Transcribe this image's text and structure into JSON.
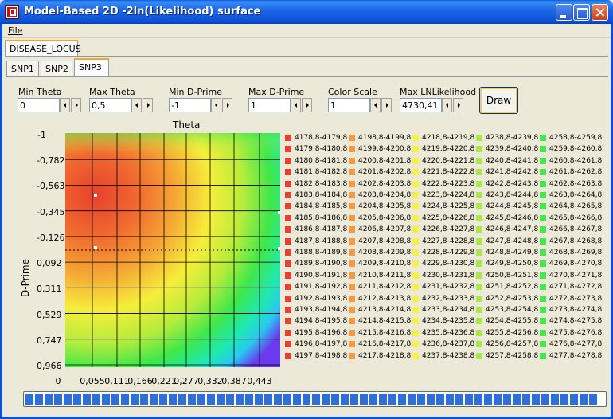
{
  "window": {
    "title": "Model-Based 2D -2ln(Likelihood) surface"
  },
  "menu": {
    "file": "File"
  },
  "tabs": {
    "outer": "DISEASE_LOCUS",
    "inner": [
      "SNP1",
      "SNP2",
      "SNP3"
    ],
    "active": "SNP3"
  },
  "controls": {
    "min_theta": {
      "label": "Min Theta",
      "value": "0"
    },
    "max_theta": {
      "label": "Max Theta",
      "value": "0,5"
    },
    "min_dprime": {
      "label": "Min D-Prime",
      "value": "-1"
    },
    "max_dprime": {
      "label": "Max D-Prime",
      "value": "1"
    },
    "color_scale": {
      "label": "Color Scale",
      "value": "1"
    },
    "max_lnlikelihood": {
      "label": "Max LNLikelihood",
      "value": "4730,41"
    },
    "draw": "Draw"
  },
  "chart_data": {
    "type": "heatmap",
    "title": "",
    "xlabel": "Theta",
    "ylabel": "D-Prime",
    "x_ticks": [
      "0",
      "0,055",
      "0,111",
      "0,166",
      "0,221",
      "0,277",
      "0,332",
      "0,387",
      "0,443"
    ],
    "y_ticks": [
      "-1",
      "-0,782",
      "-0,563",
      "-0,345",
      "-0,126",
      "0,092",
      "0,311",
      "0,529",
      "0,747",
      "0,966"
    ],
    "xlim": [
      0,
      0.5
    ],
    "ylim": [
      -1,
      1
    ],
    "grid": true,
    "dashed_line_dprime": 0.0,
    "markers": [
      {
        "theta": 0.06,
        "dprime": -0.47
      },
      {
        "theta": 0.06,
        "dprime": -0.02
      }
    ],
    "legend": {
      "columns": [
        {
          "color": "#e8412d",
          "entries": [
            "4178,8-4179,8",
            "4179,8-4180,8",
            "4180,8-4181,8",
            "4181,8-4182,8",
            "4182,8-4183,8",
            "4183,8-4184,8",
            "4184,8-4185,8",
            "4185,8-4186,8",
            "4186,8-4187,8",
            "4187,8-4188,8",
            "4188,8-4189,8",
            "4189,8-4190,8",
            "4190,8-4191,8",
            "4191,8-4192,8",
            "4192,8-4193,8",
            "4193,8-4194,8",
            "4194,8-4195,8",
            "4195,8-4196,8",
            "4196,8-4197,8",
            "4197,8-4198,8"
          ]
        },
        {
          "color": "#f29a45",
          "entries": [
            "4198,8-4199,8",
            "4199,8-4200,8",
            "4200,8-4201,8",
            "4201,8-4202,8",
            "4202,8-4203,8",
            "4203,8-4204,8",
            "4204,8-4205,8",
            "4205,8-4206,8",
            "4206,8-4207,8",
            "4207,8-4208,8",
            "4208,8-4209,8",
            "4209,8-4210,8",
            "4210,8-4211,8",
            "4211,8-4212,8",
            "4212,8-4213,8",
            "4213,8-4214,8",
            "4214,8-4215,8",
            "4215,8-4216,8",
            "4216,8-4217,8",
            "4217,8-4218,8"
          ]
        },
        {
          "color": "#f7ef4a",
          "entries": [
            "4218,8-4219,8",
            "4219,8-4220,8",
            "4220,8-4221,8",
            "4221,8-4222,8",
            "4222,8-4223,8",
            "4223,8-4224,8",
            "4224,8-4225,8",
            "4225,8-4226,8",
            "4226,8-4227,8",
            "4227,8-4228,8",
            "4228,8-4229,8",
            "4229,8-4230,8",
            "4230,8-4231,8",
            "4231,8-4232,8",
            "4232,8-4233,8",
            "4233,8-4234,8",
            "4234,8-4235,8",
            "4235,8-4236,8",
            "4236,8-4237,8",
            "4237,8-4238,8"
          ]
        },
        {
          "color": "#a9e84a",
          "entries": [
            "4238,8-4239,8",
            "4239,8-4240,8",
            "4240,8-4241,8",
            "4241,8-4242,8",
            "4242,8-4243,8",
            "4243,8-4244,8",
            "4244,8-4245,8",
            "4245,8-4246,8",
            "4246,8-4247,8",
            "4247,8-4248,8",
            "4248,8-4249,8",
            "4249,8-4250,8",
            "4250,8-4251,8",
            "4251,8-4252,8",
            "4252,8-4253,8",
            "4253,8-4254,8",
            "4254,8-4255,8",
            "4255,8-4256,8",
            "4256,8-4257,8",
            "4257,8-4258,8"
          ]
        },
        {
          "color": "#45e84a",
          "entries": [
            "4258,8-4259,8",
            "4259,8-4260,8",
            "4260,8-4261,8",
            "4261,8-4262,8",
            "4262,8-4263,8",
            "4263,8-4264,8",
            "4264,8-4265,8",
            "4265,8-4266,8",
            "4266,8-4267,8",
            "4267,8-4268,8",
            "4268,8-4269,8",
            "4269,8-4270,8",
            "4270,8-4271,8",
            "4271,8-4272,8",
            "4272,8-4273,8",
            "4273,8-4274,8",
            "4274,8-4275,8",
            "4275,8-4276,8",
            "4276,8-4277,8",
            "4277,8-4278,8"
          ]
        }
      ]
    }
  },
  "progress": {
    "value": 1.0
  }
}
